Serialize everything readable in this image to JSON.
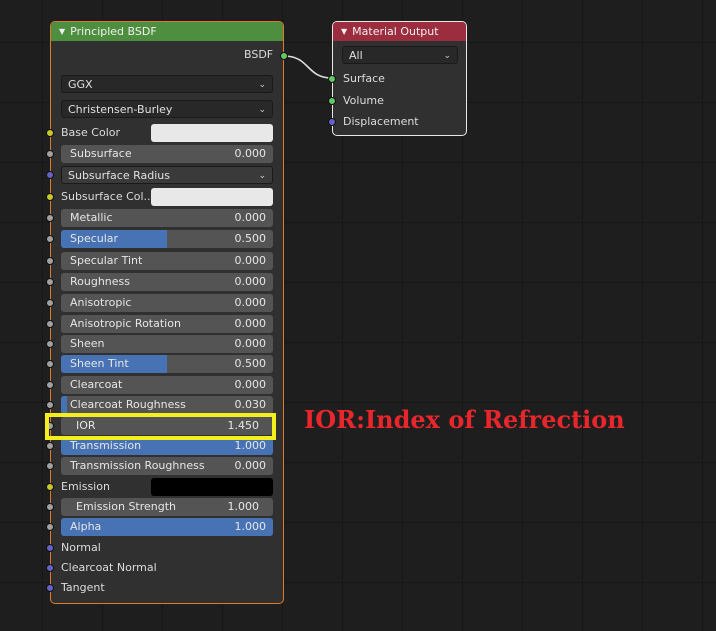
{
  "bsdf_node": {
    "title": "Principled BSDF",
    "output_label": "BSDF",
    "distribution": "GGX",
    "subsurface_method": "Christensen-Burley",
    "inputs": {
      "base_color": {
        "label": "Base Color",
        "color": "#e8e8e8"
      },
      "subsurface": {
        "label": "Subsurface",
        "value": "0.000",
        "fraction": 0
      },
      "subsurface_radius": {
        "label": "Subsurface Radius"
      },
      "subsurface_color": {
        "label": "Subsurface Col...",
        "color": "#e8e8e8"
      },
      "metallic": {
        "label": "Metallic",
        "value": "0.000",
        "fraction": 0
      },
      "specular": {
        "label": "Specular",
        "value": "0.500",
        "fraction": 0.5
      },
      "specular_tint": {
        "label": "Specular Tint",
        "value": "0.000",
        "fraction": 0
      },
      "roughness": {
        "label": "Roughness",
        "value": "0.000",
        "fraction": 0
      },
      "anisotropic": {
        "label": "Anisotropic",
        "value": "0.000",
        "fraction": 0
      },
      "anisotropic_rotation": {
        "label": "Anisotropic Rotation",
        "value": "0.000",
        "fraction": 0
      },
      "sheen": {
        "label": "Sheen",
        "value": "0.000",
        "fraction": 0
      },
      "sheen_tint": {
        "label": "Sheen Tint",
        "value": "0.500",
        "fraction": 0.5
      },
      "clearcoat": {
        "label": "Clearcoat",
        "value": "0.000",
        "fraction": 0
      },
      "clearcoat_roughness": {
        "label": "Clearcoat Roughness",
        "value": "0.030",
        "fraction": 0.03
      },
      "ior": {
        "label": "IOR",
        "value": "1.450"
      },
      "transmission": {
        "label": "Transmission",
        "value": "1.000",
        "fraction": 1
      },
      "transmission_roughness": {
        "label": "Transmission Roughness",
        "value": "0.000",
        "fraction": 0
      },
      "emission": {
        "label": "Emission",
        "color": "#000000"
      },
      "emission_strength": {
        "label": "Emission Strength",
        "value": "1.000"
      },
      "alpha": {
        "label": "Alpha",
        "value": "1.000",
        "fraction": 1
      },
      "normal": {
        "label": "Normal"
      },
      "clearcoat_normal": {
        "label": "Clearcoat Normal"
      },
      "tangent": {
        "label": "Tangent"
      }
    }
  },
  "output_node": {
    "title": "Material Output",
    "target": "All",
    "inputs": [
      "Surface",
      "Volume",
      "Displacement"
    ]
  },
  "annotation": {
    "text": "IOR:Index of Refrection",
    "color": "#e8262c"
  },
  "colors": {
    "shader_header": "#4d8f3e",
    "output_header": "#9b2d3e",
    "slider_fill": "#4772b3",
    "highlight": "#f3ee1c"
  }
}
